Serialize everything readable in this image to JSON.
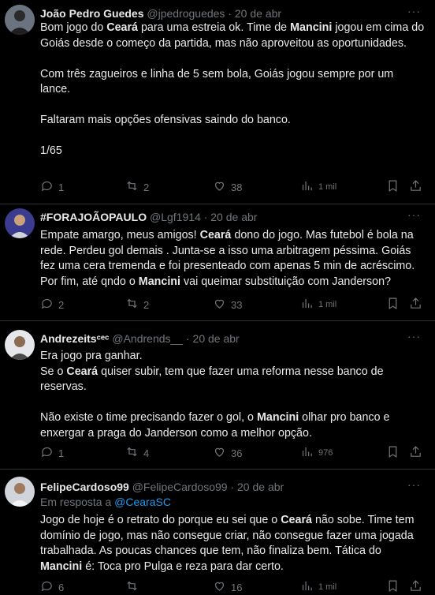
{
  "tweets": [
    {
      "display_name": "João Pedro Guedes",
      "handle": "@jpedroguedes",
      "separator": "·",
      "date": "20 de abr",
      "more": "···",
      "paragraphs": [
        [
          [
            "Bom jogo do ",
            false
          ],
          [
            "Ceará",
            true
          ],
          [
            " para uma estreia ok. Time de ",
            false
          ],
          [
            "Mancini",
            true
          ],
          [
            " jogou em cima do Goiás desde o começo da partida, mas não aproveitou as oportunidades.",
            false
          ]
        ],
        [
          [
            "Com três zagueiros e linha de 5 sem bola, Goiás jogou sempre por um lance.",
            false
          ]
        ],
        [
          [
            "Faltaram mais opções ofensivas saindo do banco.",
            false
          ]
        ],
        [
          [
            "1/65",
            false
          ]
        ]
      ],
      "replies": "1",
      "retweets": "2",
      "likes": "38",
      "views": "1 mil"
    },
    {
      "display_name": "#FORAJOÃOPAULO",
      "handle": "@Lgf1914",
      "separator": "·",
      "date": "20 de abr",
      "more": "···",
      "paragraphs": [
        [
          [
            "Empate amargo, meus amigos! ",
            false
          ],
          [
            "Ceará",
            true
          ],
          [
            " dono do jogo. Mas futebol é bola na rede. Perdeu gol demais . Junta-se a isso uma arbitragem péssima. Goiás fez uma cera tremenda e foi presenteado com apenas 5 min de acréscimo. Por fim, até qndo o ",
            false
          ],
          [
            "Mancini",
            true
          ],
          [
            " vai queimar substituição com Janderson?",
            false
          ]
        ]
      ],
      "replies": "2",
      "retweets": "2",
      "likes": "33",
      "views": "1 mil"
    },
    {
      "display_name": "Andrezeitsᶜᵉᶜ",
      "handle": "@Andrends__",
      "separator": "·",
      "date": "20 de abr",
      "more": "···",
      "paragraphs": [
        [
          [
            "Era jogo pra ganhar.\nSe o ",
            false
          ],
          [
            "Ceará",
            true
          ],
          [
            " quiser subir, tem que fazer uma reforma nesse banco de reservas.",
            false
          ]
        ],
        [
          [
            "Não existe o time precisando fazer o gol, o ",
            false
          ],
          [
            "Mancini",
            true
          ],
          [
            " olhar pro banco e enxergar a praga do Janderson como a melhor opção.",
            false
          ]
        ]
      ],
      "replies": "1",
      "retweets": "4",
      "likes": "36",
      "views": "976"
    },
    {
      "display_name": "FelipeCardoso99",
      "handle": "@FelipeCardoso99",
      "separator": "·",
      "date": "20 de abr",
      "more": "···",
      "reply_prefix": "Em resposta a ",
      "reply_target": "@CearaSC",
      "paragraphs": [
        [
          [
            "Jogo de hoje é o retrato do porque eu sei que o ",
            false
          ],
          [
            "Ceará",
            true
          ],
          [
            " não sobe. Time tem domínio de jogo, mas não consegue criar, não consegue fazer uma jogada trabalhada. As poucas chances que tem, não finaliza bem. Tática do ",
            false
          ],
          [
            "Mancini",
            true
          ],
          [
            " é: Toca pro Pulga e reza para dar certo.",
            false
          ]
        ]
      ],
      "replies": "6",
      "retweets": "",
      "likes": "16",
      "views": "1 mil"
    }
  ],
  "colors": {
    "background": "#000000",
    "text": "#e7e9ea",
    "secondary": "#71767b",
    "link": "#1d9bf0",
    "divider": "#2f3336"
  },
  "icons": [
    "reply-icon",
    "retweet-icon",
    "like-icon",
    "views-icon",
    "bookmark-icon",
    "share-icon",
    "more-icon"
  ]
}
